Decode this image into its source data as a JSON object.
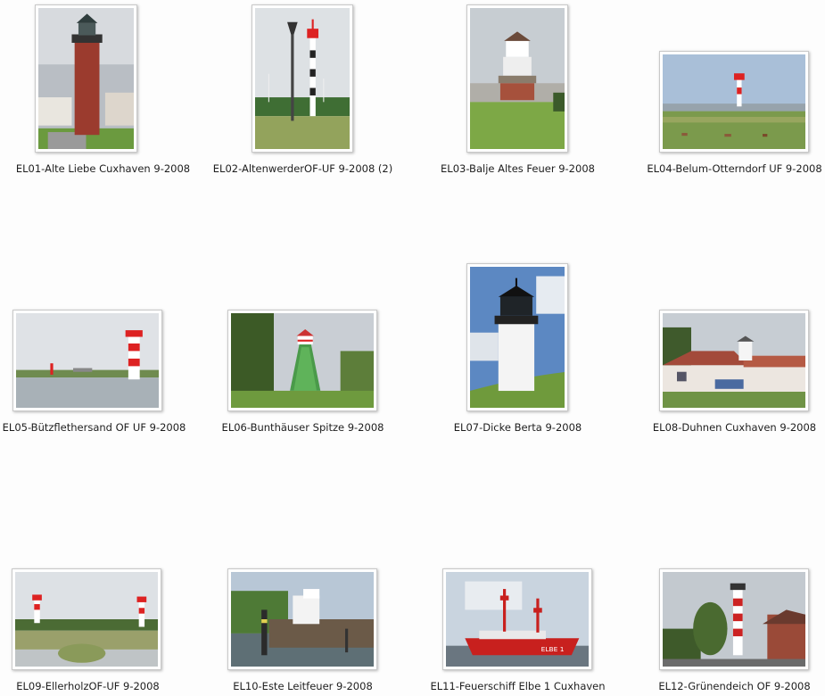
{
  "files": [
    {
      "name": "EL01-Alte Liebe Cuxhaven 9-2008",
      "icon": "lighthouse-photo-icon"
    },
    {
      "name": "EL02-AltenwerderOF-UF 9-2008 (2)",
      "icon": "lighthouse-photo-icon"
    },
    {
      "name": "EL03-Balje Altes Feuer 9-2008",
      "icon": "lighthouse-photo-icon"
    },
    {
      "name": "EL04-Belum-Otterndorf UF 9-2008",
      "icon": "lighthouse-photo-icon"
    },
    {
      "name": "EL05-Bützflethersand OF UF 9-2008",
      "icon": "lighthouse-photo-icon"
    },
    {
      "name": "EL06-Bunthäuser Spitze 9-2008",
      "icon": "lighthouse-photo-icon"
    },
    {
      "name": "EL07-Dicke Berta 9-2008",
      "icon": "lighthouse-photo-icon"
    },
    {
      "name": "EL08-Duhnen Cuxhaven 9-2008",
      "icon": "lighthouse-photo-icon"
    },
    {
      "name": "EL09-EllerholzOF-UF 9-2008",
      "icon": "lighthouse-photo-icon"
    },
    {
      "name": "EL10-Este Leitfeuer 9-2008",
      "icon": "lighthouse-photo-icon"
    },
    {
      "name": "EL11-Feuerschiff Elbe 1 Cuxhaven",
      "icon": "lightship-photo-icon"
    },
    {
      "name": "EL12-Grünendeich OF 9-2008",
      "icon": "lighthouse-photo-icon"
    }
  ]
}
